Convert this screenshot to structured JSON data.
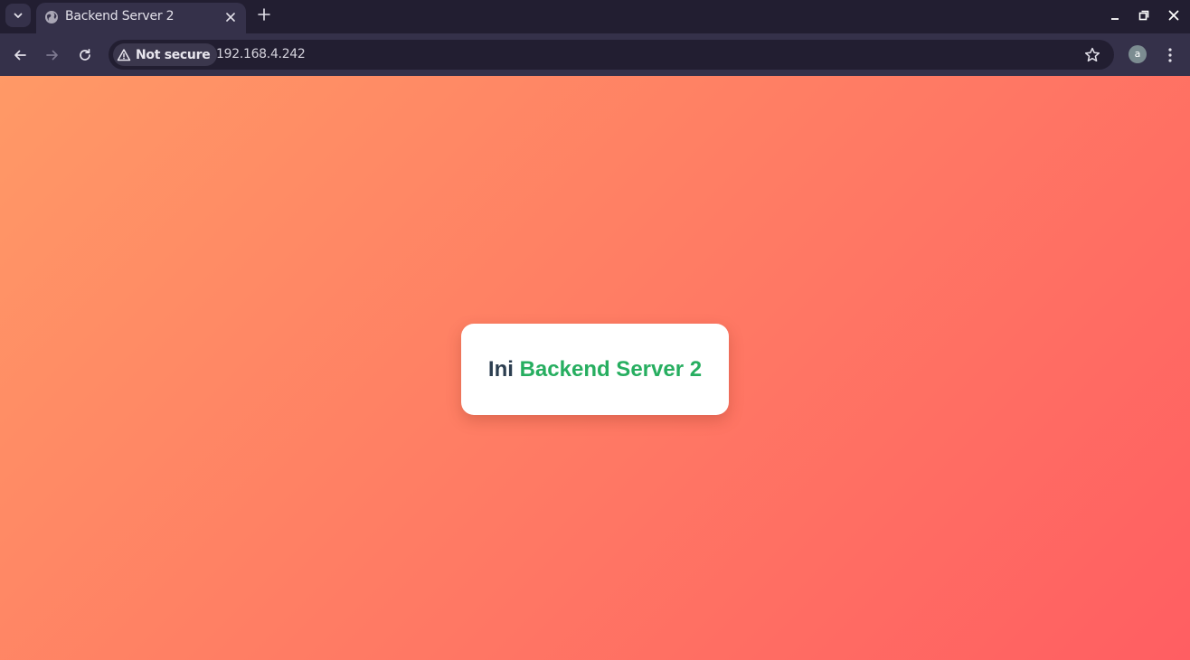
{
  "browser": {
    "tab": {
      "title": "Backend Server 2",
      "favicon": "globe-icon"
    },
    "address_bar": {
      "security_label": "Not secure",
      "url": "192.168.4.242"
    },
    "profile": {
      "initial": "a"
    }
  },
  "page": {
    "heading_lead": "Ini",
    "heading_accent": "Backend Server 2",
    "colors": {
      "gradient_start": "#ff9966",
      "gradient_end": "#ff5e62",
      "heading_text": "#2c3e50",
      "accent_text": "#27ae60"
    }
  }
}
